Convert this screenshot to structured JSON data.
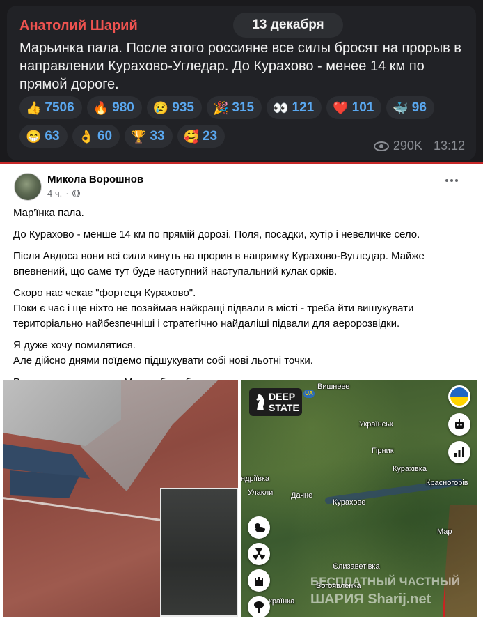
{
  "telegram": {
    "author": "Анатолий Шарий",
    "date": "13 декабря",
    "text": "Марьинка пала. После этого россияне все силы бросят на прорыв в направлении Курахово-Угледар. До Курахово - менее 14 км по прямой дороге.",
    "reactions_row1": [
      {
        "emoji": "👍",
        "icon": "thumbs-up-icon",
        "count": "7506"
      },
      {
        "emoji": "🔥",
        "icon": "fire-icon",
        "count": "980"
      },
      {
        "emoji": "😢",
        "icon": "crying-face-icon",
        "count": "935"
      },
      {
        "emoji": "🎉",
        "icon": "party-popper-icon",
        "count": "315"
      },
      {
        "emoji": "👀",
        "icon": "eyes-icon",
        "count": "121"
      },
      {
        "emoji": "❤️",
        "icon": "heart-icon",
        "count": "101"
      },
      {
        "emoji": "🐳",
        "icon": "whale-icon",
        "count": "96"
      }
    ],
    "reactions_row2": [
      {
        "emoji": "😁",
        "icon": "grinning-face-icon",
        "count": "63"
      },
      {
        "emoji": "👌",
        "icon": "ok-hand-icon",
        "count": "60"
      },
      {
        "emoji": "🏆",
        "icon": "trophy-icon",
        "count": "33"
      },
      {
        "emoji": "🥰",
        "icon": "smiling-hearts-icon",
        "count": "23"
      }
    ],
    "views": "290K",
    "time": "13:12"
  },
  "facebook": {
    "author": "Микола Ворошнов",
    "time": "4 ч.",
    "paragraphs": [
      [
        "Мар'їнка пала."
      ],
      [
        "До Курахово - менше 14 км по прямій дорозі. Поля, посадки, хутір і невеличке село."
      ],
      [
        "Після Авдоса вони всі сили кинуть на прорив в напрямку Курахово-Вугледар. Майже впевнений, що саме тут буде наступний наступальний кулак орків."
      ],
      [
        "Скоро нас чекає \"фортеця Курахово\".",
        "Поки є час і ще ніхто не позаймав найкращі підвали в місті - треба йти вишукувати територіально найбезпечніші і стратегічно найдаліші підвали для аеророзвідки."
      ],
      [
        "Я дуже хочу помилятися.",
        "Але дійсно днями поїдемо підшукувати собі нові льотні точки."
      ],
      [
        "Водосховище, висоти. Можна буде бадатися з ордою."
      ]
    ]
  },
  "map": {
    "logo_line1": "DEEP",
    "logo_line2": "STATE",
    "badge": "UA",
    "labels": {
      "vyshneve": "Вишневе",
      "ukrainsk": "Українськ",
      "hirnyk": "Гірник",
      "kurakhivka": "Курахівка",
      "krasnohorivka": "Красногорів",
      "andriivka": "ндріївка",
      "ulakly": "Улакли",
      "dachne": "Дачне",
      "kurakhove": "Курахове",
      "marinka": "Мар",
      "yelyzavetivka": "Єлизаветівка",
      "bohoiavlenka": "Богоявленка",
      "krainka": "країнка"
    }
  },
  "watermark": {
    "line1": "БЕСПЛАТНЫЙ ЧАСТНЫЙ",
    "line2": "ШАРИЯ Sharij.net"
  },
  "colors": {
    "tg_bg": "#212226",
    "tg_author": "#ef5350",
    "reaction_count": "#5aa8f0",
    "fb_text": "#050505",
    "divider": "#c62828"
  }
}
